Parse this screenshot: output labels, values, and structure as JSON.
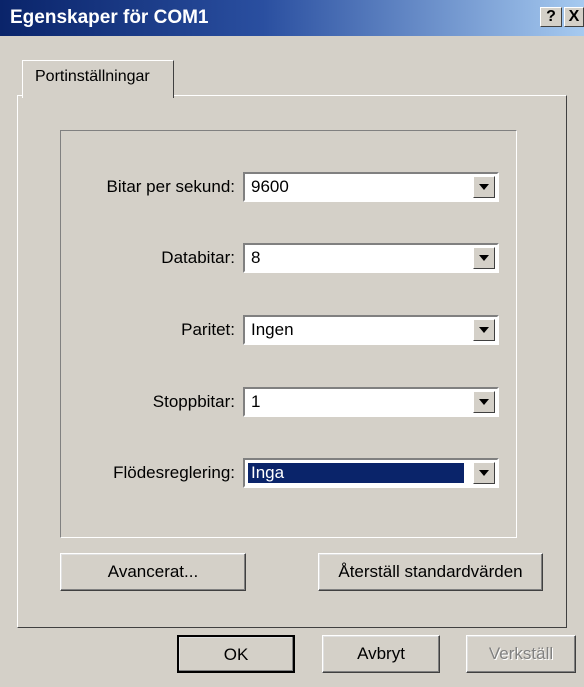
{
  "window": {
    "title": "Egenskaper för COM1",
    "help_glyph": "?",
    "close_glyph": "X"
  },
  "tab": {
    "label": "Portinställningar"
  },
  "fields": [
    {
      "label": "Bitar per sekund:",
      "accel": "B",
      "value": "9600"
    },
    {
      "label": "Databitar:",
      "accel": "D",
      "value": "8"
    },
    {
      "label": "Paritet:",
      "accel": "P",
      "value": "Ingen"
    },
    {
      "label": "Stoppbitar:",
      "accel": "S",
      "value": "1"
    },
    {
      "label": "Flödesreglering:",
      "accel": "F",
      "value": "Inga"
    }
  ],
  "buttons": {
    "advanced": "Avancerat...",
    "restore": "Återställ standardvärden",
    "ok": "OK",
    "cancel": "Avbryt",
    "apply": "Verkställ"
  },
  "icons": {
    "help": "help-icon",
    "close": "close-icon",
    "dropdown": "chevron-down-icon"
  },
  "colors": {
    "titlebar": "#0a246a",
    "face": "#d4d0c8",
    "selection": "#0a246a"
  }
}
